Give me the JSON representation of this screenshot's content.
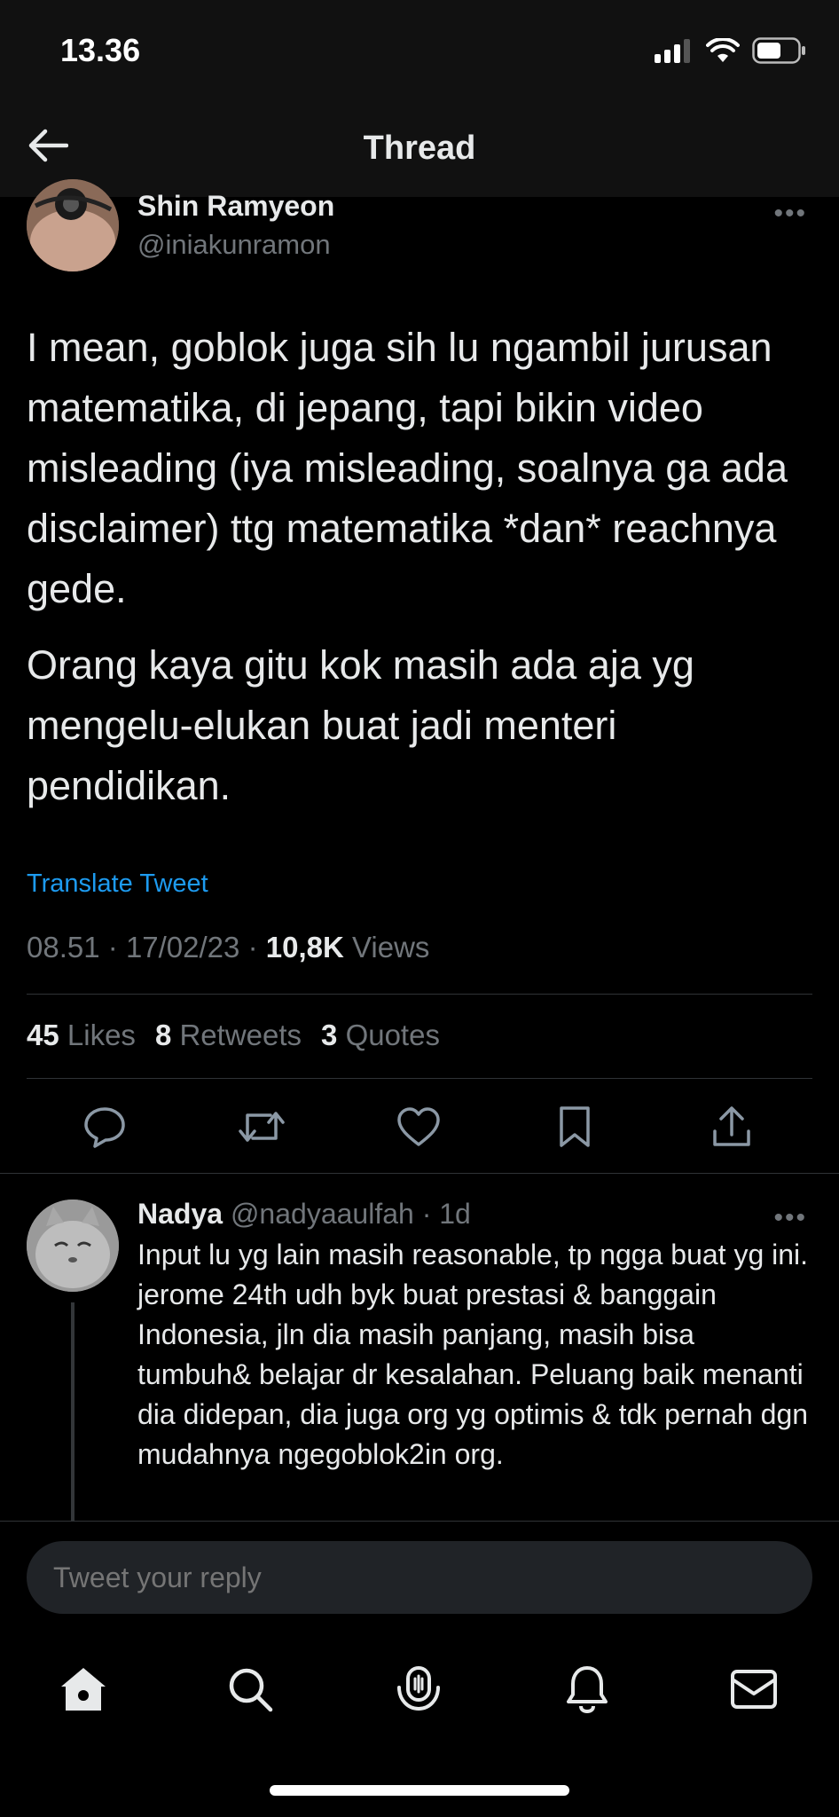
{
  "status_bar": {
    "time": "13.36"
  },
  "header": {
    "title": "Thread"
  },
  "tweet": {
    "author_name": "Shin Ramyeon",
    "author_handle": "@iniakunramon",
    "paragraphs": [
      "I mean, goblok juga sih lu ngambil jurusan matematika, di jepang, tapi bikin video misleading (iya misleading, soalnya ga ada disclaimer) ttg matematika *dan* reachnya gede.",
      "Orang kaya gitu kok masih ada aja yg mengelu-elukan buat jadi menteri pendidikan."
    ],
    "translate_label": "Translate Tweet",
    "time": "08.51",
    "date": "17/02/23",
    "views_count": "10,8K",
    "views_label": "Views",
    "likes_count": "45",
    "likes_label": "Likes",
    "retweets_count": "8",
    "retweets_label": "Retweets",
    "quotes_count": "3",
    "quotes_label": "Quotes"
  },
  "reply": {
    "name": "Nadya",
    "handle": "@nadyaaulfah",
    "age": "1d",
    "text": "Input lu yg lain masih reasonable, tp ngga buat yg ini.\njerome 24th udh byk buat prestasi & banggain Indonesia, jln dia masih panjang, masih bisa tumbuh& belajar dr kesalahan.  Peluang baik menanti dia didepan, dia juga org yg optimis & tdk pernah dgn mudahnya ngegoblok2in org."
  },
  "composer": {
    "placeholder": "Tweet your reply"
  },
  "icons": {
    "back": "arrow-left-icon",
    "reply": "speech-bubble-icon",
    "retweet": "retweet-icon",
    "like": "heart-icon",
    "bookmark": "bookmark-icon",
    "share": "share-icon",
    "home": "home-icon",
    "search": "search-icon",
    "spaces": "spaces-icon",
    "notifications": "bell-icon",
    "messages": "envelope-icon"
  },
  "colors": {
    "background": "#000000",
    "link": "#1d9bf0",
    "muted": "#71767b",
    "text": "#e7e9ea"
  }
}
